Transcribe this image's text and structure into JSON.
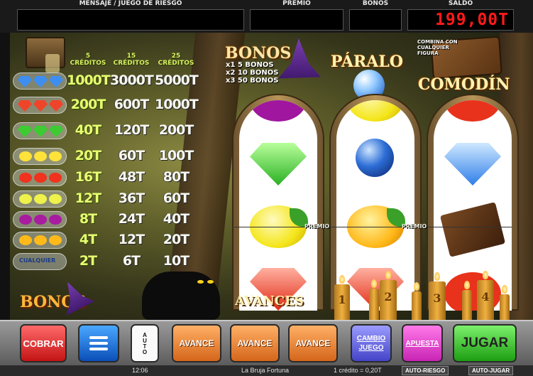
{
  "top_bar": {
    "message_label": "MENSAJE / JUEGO DE RIESGO",
    "message_value": "",
    "premio_label": "PREMIO",
    "premio_value": "",
    "bonos_label": "BONOS",
    "bonos_value": "",
    "saldo_label": "SALDO",
    "saldo_value": "199,00T"
  },
  "paytable": {
    "columns": [
      "5\nCRÉDITOS",
      "15\nCRÉDITOS",
      "25\nCRÉDITOS"
    ],
    "rows": [
      {
        "symbol": "blue-diamond-icon",
        "values": [
          "1000T",
          "3000T",
          "5000T"
        ]
      },
      {
        "symbol": "red-diamond-icon",
        "values": [
          "200T",
          "600T",
          "1000T"
        ]
      },
      {
        "symbol": "green-diamond-icon",
        "values": [
          "40T",
          "120T",
          "200T"
        ]
      },
      {
        "symbol": "banana-icon",
        "values": [
          "20T",
          "60T",
          "100T"
        ]
      },
      {
        "symbol": "strawberry-icon",
        "values": [
          "16T",
          "48T",
          "80T"
        ]
      },
      {
        "symbol": "lemon-icon",
        "values": [
          "12T",
          "36T",
          "60T"
        ]
      },
      {
        "symbol": "plum-icon",
        "values": [
          "8T",
          "24T",
          "40T"
        ]
      },
      {
        "symbol": "orange-icon",
        "values": [
          "4T",
          "12T",
          "20T"
        ]
      },
      {
        "symbol": "any-diamond-icon",
        "label": "CUALQUIER",
        "values": [
          "2T",
          "6T",
          "10T"
        ]
      }
    ]
  },
  "bonus_info": {
    "title": "BONOS",
    "lines": [
      "x1 5 BONOS",
      "x2 10 BONOS",
      "x3 50 BONOS"
    ]
  },
  "paralo": "PÁRALO",
  "comodin": {
    "title": "COMODÍN",
    "hint": "COMBINA CON\nCUALQUIER\nFIGURA"
  },
  "reels": {
    "premio_marker": "PREMIO",
    "reel_1": [
      "plum",
      "green-diamond",
      "lemon",
      "red-diamond"
    ],
    "reel_2": [
      "lemon",
      "crystal-ball",
      "orange",
      "red-diamond"
    ],
    "reel_3": [
      "strawberry",
      "blue-diamond",
      "book",
      "strawberry"
    ]
  },
  "bonos_label": "BONOS",
  "avances_label": "AVANCES",
  "candles": [
    "1",
    "2",
    "3",
    "4"
  ],
  "controls": {
    "cobrar": "COBRAR",
    "auto": "AUTO",
    "avance_1": "AVANCE",
    "avance_2": "AVANCE",
    "avance_3": "AVANCE",
    "cambio_juego": "CAMBIO\nJUEGO",
    "apuesta": "APUESTA",
    "jugar": "JUGAR"
  },
  "status_bar": {
    "time": "12:06",
    "game_name": "La Bruja Fortuna",
    "credit_value": "1 crédito = 0,20T",
    "auto_riesgo": "AUTO-RIESGO",
    "auto_jugar": "AUTO-JUGAR"
  },
  "colors": {
    "saldo_digits": "#ff1a1a",
    "cobrar": "#c31414",
    "menu": "#0b4fb8",
    "avance": "#d4661a",
    "cambio": "#4444c8",
    "apuesta": "#c824b4",
    "jugar": "#1d9e12"
  }
}
